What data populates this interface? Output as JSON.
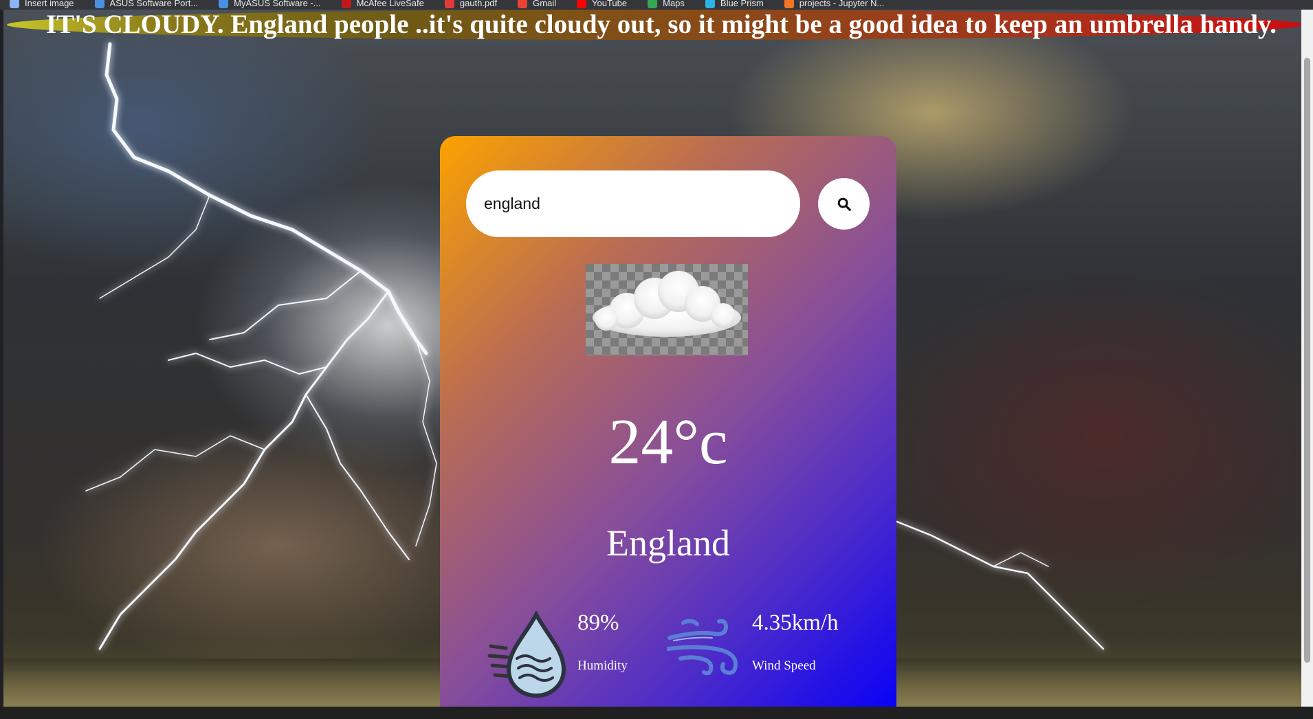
{
  "bookmarks": [
    {
      "label": "Insert image",
      "icon": "globe-icon",
      "color": "#8ab4f8"
    },
    {
      "label": "ASUS Software Port...",
      "icon": "asus-icon",
      "color": "#4a90e2"
    },
    {
      "label": "MyASUS Software -...",
      "icon": "asus-icon",
      "color": "#4a90e2"
    },
    {
      "label": "McAfee LiveSafe",
      "icon": "mcafee-icon",
      "color": "#c01818"
    },
    {
      "label": "gauth.pdf",
      "icon": "pdf-icon",
      "color": "#e53935"
    },
    {
      "label": "Gmail",
      "icon": "gmail-icon",
      "color": "#ea4335"
    },
    {
      "label": "YouTube",
      "icon": "youtube-icon",
      "color": "#ff0000"
    },
    {
      "label": "Maps",
      "icon": "maps-icon",
      "color": "#34a853"
    },
    {
      "label": "Blue Prism",
      "icon": "blue-prism-icon",
      "color": "#2ab3e6"
    },
    {
      "label": "projects - Jupyter N...",
      "icon": "jupyter-icon",
      "color": "#f37626"
    }
  ],
  "banner": {
    "text": "IT'S CLOUDY. England people ..it's quite cloudy out, so it might be a good idea to keep an umbrella handy."
  },
  "weather": {
    "search_value": "england",
    "weather_icon": "cloud-icon",
    "temperature": "24°c",
    "city": "England",
    "humidity_value": "89%",
    "humidity_label": "Humidity",
    "humidity_icon": "humidity-drop-icon",
    "wind_value": "4.35km/h",
    "wind_label": "Wind Speed",
    "wind_icon": "wind-icon"
  },
  "colors": {
    "card_gradient_start": "#fca200",
    "card_gradient_end": "#0a02f6",
    "banner_gradient_start": "#c8c62a",
    "banner_gradient_end": "#cc0d10"
  }
}
